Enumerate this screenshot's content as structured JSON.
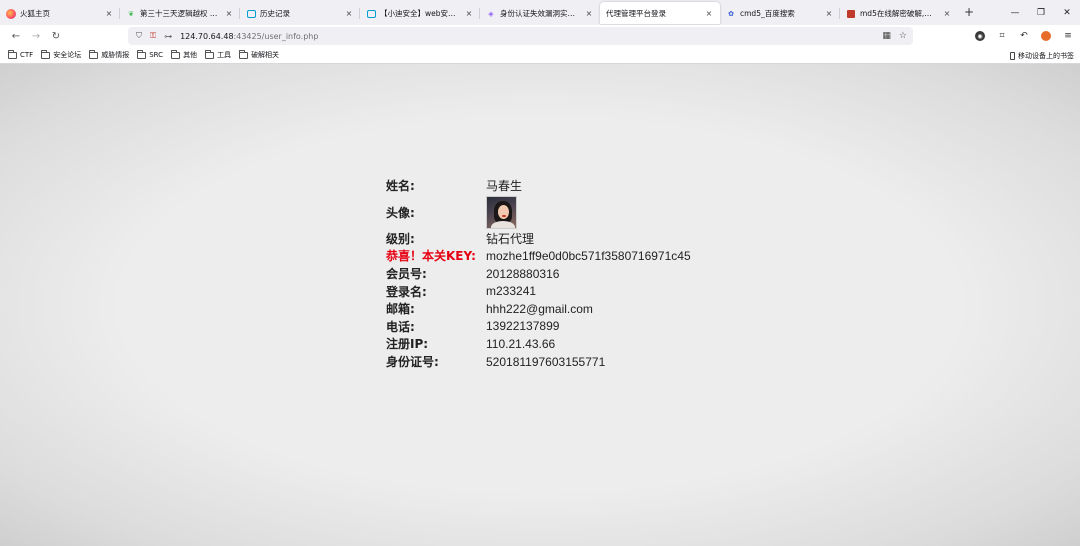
{
  "tabs": [
    {
      "title": "火狐主页",
      "icon": "firefox-icon",
      "active": false
    },
    {
      "title": "第三十三天逻辑越权 - 语雀",
      "icon": "yuque-leaf-icon",
      "active": false
    },
    {
      "title": "历史记录",
      "icon": "bilibili-tv-icon",
      "active": false
    },
    {
      "title": "【小迪安全】web安全 | 渗透",
      "icon": "bilibili-tv-icon",
      "active": false
    },
    {
      "title": "身份认证失效漏洞实战_身份认",
      "icon": "csdn-badge-icon",
      "active": false
    },
    {
      "title": "代理管理平台登录",
      "icon": "",
      "active": true
    },
    {
      "title": "cmd5_百度搜索",
      "icon": "baidu-paw-icon",
      "active": false
    },
    {
      "title": "md5在线解密破解,md5解密加",
      "icon": "md5-site-icon",
      "active": false
    }
  ],
  "tab_close_glyph": "×",
  "new_tab_glyph": "+",
  "window_controls": {
    "minimize": "—",
    "maximize": "❐",
    "close": "✕"
  },
  "url": {
    "host": "124.70.64.48",
    "path": ":43425/user_info.php"
  },
  "bookmarks": [
    "CTF",
    "安全论坛",
    "威胁情报",
    "SRC",
    "其他",
    "工具",
    "破解相关"
  ],
  "mobile_bookmarks": "移动设备上的书签",
  "user_info": {
    "name_label": "姓名:",
    "name": "马春生",
    "avatar_label": "头像:",
    "level_label": "级别:",
    "level": "钻石代理",
    "key_label": "恭喜！本关KEY:",
    "key": "mozhe1ff9e0d0bc571f3580716971c45",
    "member_no_label": "会员号:",
    "member_no": "20128880316",
    "login_label": "登录名:",
    "login": "m233241",
    "email_label": "邮箱:",
    "email": "hhh222@gmail.com",
    "phone_label": "电话:",
    "phone": "13922137899",
    "reg_ip_label": "注册IP:",
    "reg_ip": "110.21.43.66",
    "id_label": "身份证号:",
    "id_no": "520181197603155771"
  },
  "colors": {
    "key_label": "#e60012",
    "page_bg": "#ebebeb"
  }
}
